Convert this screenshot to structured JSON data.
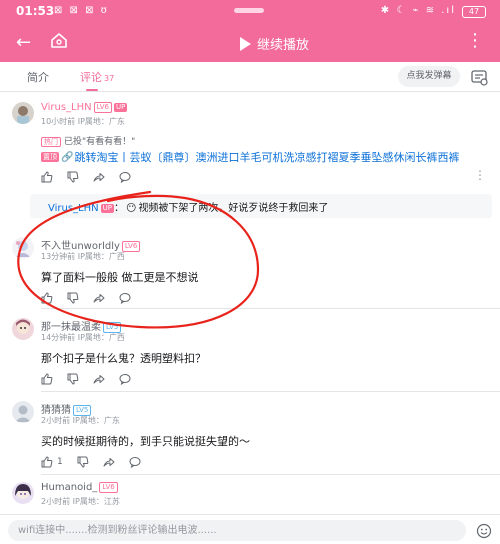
{
  "status_bar": {
    "time": "01:53",
    "left_icons": "⊠ ⊠ ⊠ ʊ",
    "right_icons": "✱ ☾ ⌁ ≋ .ıl",
    "battery": "47"
  },
  "app_bar": {
    "play_label": "继续播放"
  },
  "tabs": {
    "intro": "简介",
    "comments": "评论",
    "comment_count": "37",
    "danmaku_placeholder": "点我发弹幕"
  },
  "comments": [
    {
      "user": "Virus_LHN",
      "level": "LV6",
      "up_tag": "UP",
      "meta": "10小时前 IP属地：广东",
      "up_quote_tag": "热门",
      "up_quote": "已投\"有看有看！\"",
      "promo_tag": "置顶",
      "promo_text": "跳转淘宝丨芸蚁〔鼎尊〕澳洲进口羊毛可机洗凉感打褶夏季垂坠感休闲长裤西裤",
      "reply": {
        "user": "Virus_LHN",
        "up_tag": "UP",
        "text": "视频被下架了两次，好说歹说终于救回来了"
      }
    },
    {
      "user": "不入世unworldly",
      "level": "LV6",
      "meta": "13分钟前 IP属地：广西",
      "text": "算了面料一般般 做工更是不想说"
    },
    {
      "user": "那一抹最温柔",
      "level": "LV5",
      "meta": "14分钟前 IP属地：广西",
      "text": "那个扣子是什么鬼？透明塑料扣？"
    },
    {
      "user": "猜猜猜",
      "level": "LV5",
      "meta": "2小时前 IP属地：广东",
      "text": "买的时候挺期待的，到手只能说挺失望的～",
      "likes": "1"
    },
    {
      "user": "Humanoid_",
      "level": "LV6",
      "meta": "2小时前 IP属地：江苏"
    }
  ],
  "bottom_bar": {
    "input_placeholder": "wifi连接中.......检测到粉丝评论输出电波......"
  },
  "colors": {
    "brand_pink": "#f36b9a",
    "link_blue": "#0c70d8",
    "annotation_red": "#e8231b"
  }
}
